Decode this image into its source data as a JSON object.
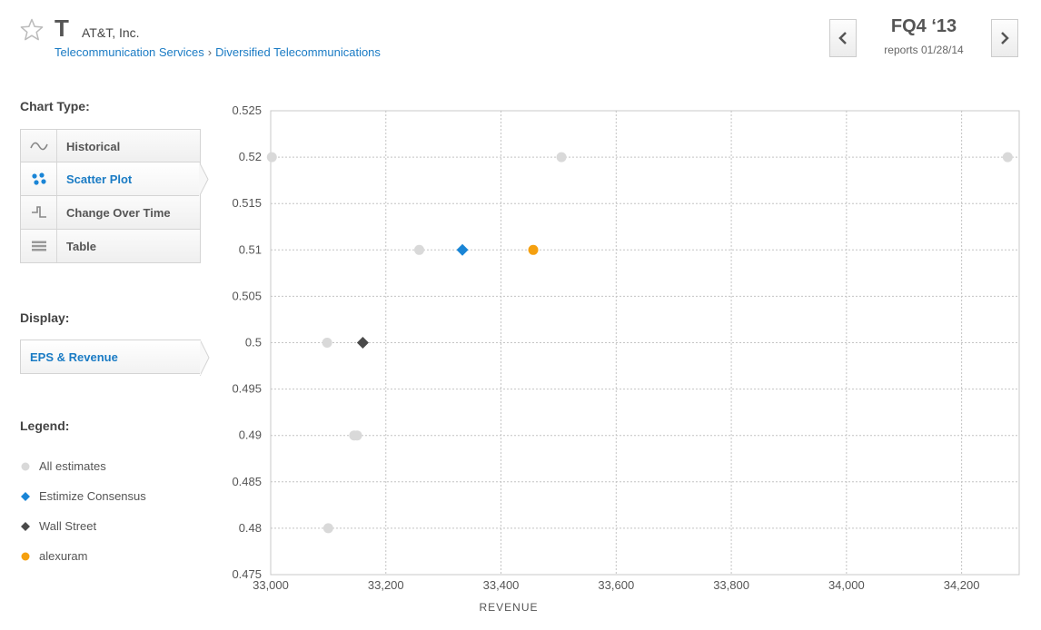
{
  "header": {
    "ticker": "T",
    "company_name": "AT&T, Inc.",
    "breadcrumb": [
      "Telecommunication Services",
      "Diversified Telecommunications"
    ],
    "breadcrumb_separator": "›",
    "quarter": "FQ4 ‘13",
    "report_date": "reports 01/28/14"
  },
  "sidebar": {
    "chart_type_label": "Chart Type:",
    "chart_types": [
      {
        "label": "Historical",
        "icon": "wave-icon",
        "active": false
      },
      {
        "label": "Scatter Plot",
        "icon": "scatter-dots-icon",
        "active": true
      },
      {
        "label": "Change Over Time",
        "icon": "step-line-icon",
        "active": false
      },
      {
        "label": "Table",
        "icon": "table-icon",
        "active": false
      }
    ],
    "display_label": "Display:",
    "display_value": "EPS & Revenue",
    "legend_label": "Legend:",
    "legend": [
      {
        "label": "All estimates",
        "marker": "circle",
        "color": "#d9d9d9"
      },
      {
        "label": "Estimize Consensus",
        "marker": "diamond",
        "color": "#1a85d6"
      },
      {
        "label": "Wall Street",
        "marker": "diamond",
        "color": "#4a4a4a"
      },
      {
        "label": "alexuram",
        "marker": "circle",
        "color": "#f5a00f"
      }
    ]
  },
  "chart_data": {
    "type": "scatter",
    "xlabel": "REVENUE",
    "ylabel": "",
    "xlim": [
      33000,
      34300
    ],
    "ylim": [
      0.475,
      0.525
    ],
    "x_ticks": [
      33000,
      33200,
      33400,
      33600,
      33800,
      34000,
      34200
    ],
    "x_tick_labels": [
      "33,000",
      "33,200",
      "33,400",
      "33,600",
      "33,800",
      "34,000",
      "34,200"
    ],
    "y_ticks": [
      0.475,
      0.48,
      0.485,
      0.49,
      0.495,
      0.5,
      0.505,
      0.51,
      0.515,
      0.52,
      0.525
    ],
    "y_tick_labels": [
      "0.475",
      "0.48",
      "0.485",
      "0.49",
      "0.495",
      "0.5",
      "0.505",
      "0.51",
      "0.515",
      "0.52",
      "0.525"
    ],
    "grid": true,
    "series": [
      {
        "name": "All estimates",
        "marker": "circle",
        "color": "#d9d9d9",
        "points": [
          [
            33002,
            0.52
          ],
          [
            33505,
            0.52
          ],
          [
            34280,
            0.52
          ],
          [
            33258,
            0.51
          ],
          [
            33098,
            0.5
          ],
          [
            33145,
            0.49
          ],
          [
            33150,
            0.49
          ],
          [
            33100,
            0.48
          ]
        ]
      },
      {
        "name": "Estimize Consensus",
        "marker": "diamond",
        "color": "#1a85d6",
        "points": [
          [
            33333,
            0.51
          ]
        ]
      },
      {
        "name": "Wall Street",
        "marker": "diamond",
        "color": "#4a4a4a",
        "points": [
          [
            33160,
            0.5
          ]
        ]
      },
      {
        "name": "alexuram",
        "marker": "circle",
        "color": "#f5a00f",
        "points": [
          [
            33456,
            0.51
          ]
        ]
      }
    ]
  }
}
